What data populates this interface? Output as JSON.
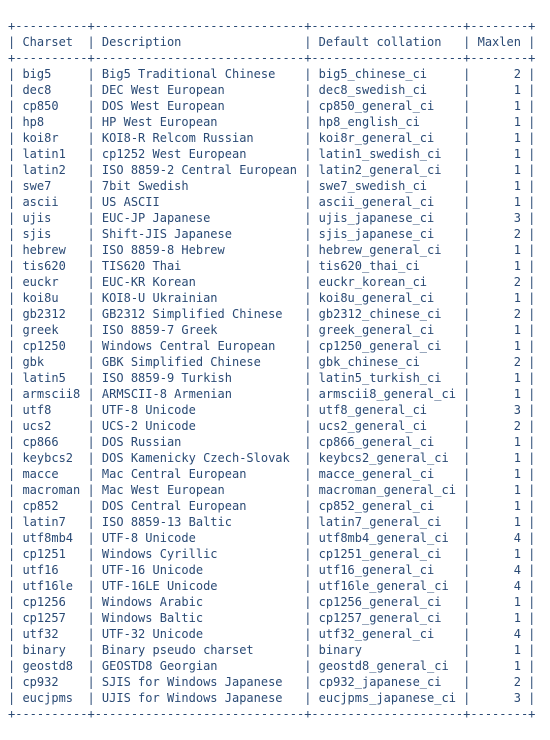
{
  "headers": {
    "charset": "Charset",
    "description": "Description",
    "collation": "Default collation",
    "maxlen": "Maxlen"
  },
  "cols": {
    "charset": 8,
    "description": 27,
    "collation": 19,
    "maxlen": 6
  },
  "rows": [
    {
      "charset": "big5",
      "description": "Big5 Traditional Chinese",
      "collation": "big5_chinese_ci",
      "maxlen": 2
    },
    {
      "charset": "dec8",
      "description": "DEC West European",
      "collation": "dec8_swedish_ci",
      "maxlen": 1
    },
    {
      "charset": "cp850",
      "description": "DOS West European",
      "collation": "cp850_general_ci",
      "maxlen": 1
    },
    {
      "charset": "hp8",
      "description": "HP West European",
      "collation": "hp8_english_ci",
      "maxlen": 1
    },
    {
      "charset": "koi8r",
      "description": "KOI8-R Relcom Russian",
      "collation": "koi8r_general_ci",
      "maxlen": 1
    },
    {
      "charset": "latin1",
      "description": "cp1252 West European",
      "collation": "latin1_swedish_ci",
      "maxlen": 1
    },
    {
      "charset": "latin2",
      "description": "ISO 8859-2 Central European",
      "collation": "latin2_general_ci",
      "maxlen": 1
    },
    {
      "charset": "swe7",
      "description": "7bit Swedish",
      "collation": "swe7_swedish_ci",
      "maxlen": 1
    },
    {
      "charset": "ascii",
      "description": "US ASCII",
      "collation": "ascii_general_ci",
      "maxlen": 1
    },
    {
      "charset": "ujis",
      "description": "EUC-JP Japanese",
      "collation": "ujis_japanese_ci",
      "maxlen": 3
    },
    {
      "charset": "sjis",
      "description": "Shift-JIS Japanese",
      "collation": "sjis_japanese_ci",
      "maxlen": 2
    },
    {
      "charset": "hebrew",
      "description": "ISO 8859-8 Hebrew",
      "collation": "hebrew_general_ci",
      "maxlen": 1
    },
    {
      "charset": "tis620",
      "description": "TIS620 Thai",
      "collation": "tis620_thai_ci",
      "maxlen": 1
    },
    {
      "charset": "euckr",
      "description": "EUC-KR Korean",
      "collation": "euckr_korean_ci",
      "maxlen": 2
    },
    {
      "charset": "koi8u",
      "description": "KOI8-U Ukrainian",
      "collation": "koi8u_general_ci",
      "maxlen": 1
    },
    {
      "charset": "gb2312",
      "description": "GB2312 Simplified Chinese",
      "collation": "gb2312_chinese_ci",
      "maxlen": 2
    },
    {
      "charset": "greek",
      "description": "ISO 8859-7 Greek",
      "collation": "greek_general_ci",
      "maxlen": 1
    },
    {
      "charset": "cp1250",
      "description": "Windows Central European",
      "collation": "cp1250_general_ci",
      "maxlen": 1
    },
    {
      "charset": "gbk",
      "description": "GBK Simplified Chinese",
      "collation": "gbk_chinese_ci",
      "maxlen": 2
    },
    {
      "charset": "latin5",
      "description": "ISO 8859-9 Turkish",
      "collation": "latin5_turkish_ci",
      "maxlen": 1
    },
    {
      "charset": "armscii8",
      "description": "ARMSCII-8 Armenian",
      "collation": "armscii8_general_ci",
      "maxlen": 1
    },
    {
      "charset": "utf8",
      "description": "UTF-8 Unicode",
      "collation": "utf8_general_ci",
      "maxlen": 3
    },
    {
      "charset": "ucs2",
      "description": "UCS-2 Unicode",
      "collation": "ucs2_general_ci",
      "maxlen": 2
    },
    {
      "charset": "cp866",
      "description": "DOS Russian",
      "collation": "cp866_general_ci",
      "maxlen": 1
    },
    {
      "charset": "keybcs2",
      "description": "DOS Kamenicky Czech-Slovak",
      "collation": "keybcs2_general_ci",
      "maxlen": 1
    },
    {
      "charset": "macce",
      "description": "Mac Central European",
      "collation": "macce_general_ci",
      "maxlen": 1
    },
    {
      "charset": "macroman",
      "description": "Mac West European",
      "collation": "macroman_general_ci",
      "maxlen": 1
    },
    {
      "charset": "cp852",
      "description": "DOS Central European",
      "collation": "cp852_general_ci",
      "maxlen": 1
    },
    {
      "charset": "latin7",
      "description": "ISO 8859-13 Baltic",
      "collation": "latin7_general_ci",
      "maxlen": 1
    },
    {
      "charset": "utf8mb4",
      "description": "UTF-8 Unicode",
      "collation": "utf8mb4_general_ci",
      "maxlen": 4
    },
    {
      "charset": "cp1251",
      "description": "Windows Cyrillic",
      "collation": "cp1251_general_ci",
      "maxlen": 1
    },
    {
      "charset": "utf16",
      "description": "UTF-16 Unicode",
      "collation": "utf16_general_ci",
      "maxlen": 4
    },
    {
      "charset": "utf16le",
      "description": "UTF-16LE Unicode",
      "collation": "utf16le_general_ci",
      "maxlen": 4
    },
    {
      "charset": "cp1256",
      "description": "Windows Arabic",
      "collation": "cp1256_general_ci",
      "maxlen": 1
    },
    {
      "charset": "cp1257",
      "description": "Windows Baltic",
      "collation": "cp1257_general_ci",
      "maxlen": 1
    },
    {
      "charset": "utf32",
      "description": "UTF-32 Unicode",
      "collation": "utf32_general_ci",
      "maxlen": 4
    },
    {
      "charset": "binary",
      "description": "Binary pseudo charset",
      "collation": "binary",
      "maxlen": 1
    },
    {
      "charset": "geostd8",
      "description": "GEOSTD8 Georgian",
      "collation": "geostd8_general_ci",
      "maxlen": 1
    },
    {
      "charset": "cp932",
      "description": "SJIS for Windows Japanese",
      "collation": "cp932_japanese_ci",
      "maxlen": 2
    },
    {
      "charset": "eucjpms",
      "description": "UJIS for Windows Japanese",
      "collation": "eucjpms_japanese_ci",
      "maxlen": 3
    }
  ]
}
